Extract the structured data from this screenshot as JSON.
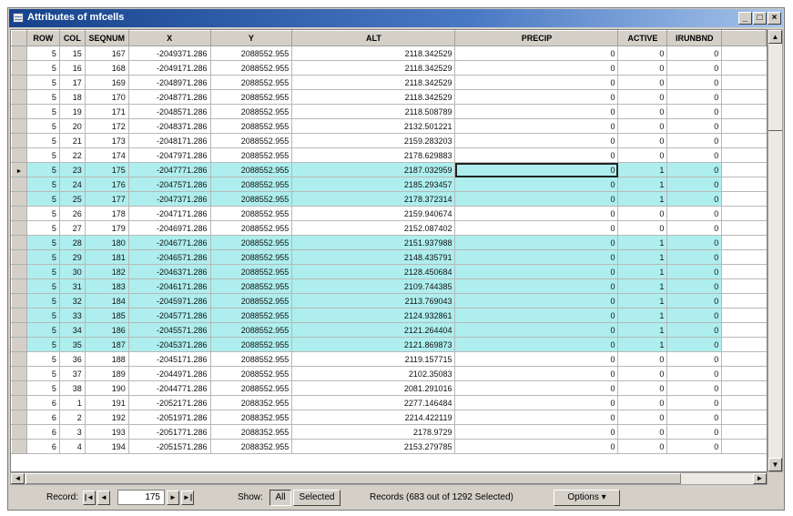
{
  "window": {
    "title": "Attributes of mfcells"
  },
  "titlebar_buttons": {
    "minimize": "_",
    "maximize": "□",
    "close": "×"
  },
  "table": {
    "columns": [
      "ROW",
      "COL",
      "SEQNUM",
      "X",
      "Y",
      "ALT",
      "PRECIP",
      "ACTIVE",
      "IRUNBND"
    ],
    "rows": [
      {
        "cells": [
          "5",
          "15",
          "167",
          "-2049371.286",
          "2088552.955",
          "2118.342529",
          "0",
          "0",
          "0"
        ],
        "highlighted": false
      },
      {
        "cells": [
          "5",
          "16",
          "168",
          "-2049171.286",
          "2088552.955",
          "2118.342529",
          "0",
          "0",
          "0"
        ],
        "highlighted": false
      },
      {
        "cells": [
          "5",
          "17",
          "169",
          "-2048971.286",
          "2088552.955",
          "2118.342529",
          "0",
          "0",
          "0"
        ],
        "highlighted": false
      },
      {
        "cells": [
          "5",
          "18",
          "170",
          "-2048771.286",
          "2088552.955",
          "2118.342529",
          "0",
          "0",
          "0"
        ],
        "highlighted": false
      },
      {
        "cells": [
          "5",
          "19",
          "171",
          "-2048571.286",
          "2088552.955",
          "2118.508789",
          "0",
          "0",
          "0"
        ],
        "highlighted": false
      },
      {
        "cells": [
          "5",
          "20",
          "172",
          "-2048371.286",
          "2088552.955",
          "2132.501221",
          "0",
          "0",
          "0"
        ],
        "highlighted": false
      },
      {
        "cells": [
          "5",
          "21",
          "173",
          "-2048171.286",
          "2088552.955",
          "2159.283203",
          "0",
          "0",
          "0"
        ],
        "highlighted": false
      },
      {
        "cells": [
          "5",
          "22",
          "174",
          "-2047971.286",
          "2088552.955",
          "2178.629883",
          "0",
          "0",
          "0"
        ],
        "highlighted": false
      },
      {
        "cells": [
          "5",
          "23",
          "175",
          "-2047771.286",
          "2088552.955",
          "2187.032959",
          "0",
          "1",
          "0"
        ],
        "highlighted": true,
        "current": true
      },
      {
        "cells": [
          "5",
          "24",
          "176",
          "-2047571.286",
          "2088552.955",
          "2185.293457",
          "0",
          "1",
          "0"
        ],
        "highlighted": true
      },
      {
        "cells": [
          "5",
          "25",
          "177",
          "-2047371.286",
          "2088552.955",
          "2178.372314",
          "0",
          "1",
          "0"
        ],
        "highlighted": true
      },
      {
        "cells": [
          "5",
          "26",
          "178",
          "-2047171.286",
          "2088552.955",
          "2159.940674",
          "0",
          "0",
          "0"
        ],
        "highlighted": false
      },
      {
        "cells": [
          "5",
          "27",
          "179",
          "-2046971.286",
          "2088552.955",
          "2152.087402",
          "0",
          "0",
          "0"
        ],
        "highlighted": false
      },
      {
        "cells": [
          "5",
          "28",
          "180",
          "-2046771.286",
          "2088552.955",
          "2151.937988",
          "0",
          "1",
          "0"
        ],
        "highlighted": true
      },
      {
        "cells": [
          "5",
          "29",
          "181",
          "-2046571.286",
          "2088552.955",
          "2148.435791",
          "0",
          "1",
          "0"
        ],
        "highlighted": true
      },
      {
        "cells": [
          "5",
          "30",
          "182",
          "-2046371.286",
          "2088552.955",
          "2128.450684",
          "0",
          "1",
          "0"
        ],
        "highlighted": true
      },
      {
        "cells": [
          "5",
          "31",
          "183",
          "-2046171.286",
          "2088552.955",
          "2109.744385",
          "0",
          "1",
          "0"
        ],
        "highlighted": true
      },
      {
        "cells": [
          "5",
          "32",
          "184",
          "-2045971.286",
          "2088552.955",
          "2113.769043",
          "0",
          "1",
          "0"
        ],
        "highlighted": true
      },
      {
        "cells": [
          "5",
          "33",
          "185",
          "-2045771.286",
          "2088552.955",
          "2124.932861",
          "0",
          "1",
          "0"
        ],
        "highlighted": true
      },
      {
        "cells": [
          "5",
          "34",
          "186",
          "-2045571.286",
          "2088552.955",
          "2121.264404",
          "0",
          "1",
          "0"
        ],
        "highlighted": true
      },
      {
        "cells": [
          "5",
          "35",
          "187",
          "-2045371.286",
          "2088552.955",
          "2121.869873",
          "0",
          "1",
          "0"
        ],
        "highlighted": true
      },
      {
        "cells": [
          "5",
          "36",
          "188",
          "-2045171.286",
          "2088552.955",
          "2119.157715",
          "0",
          "0",
          "0"
        ],
        "highlighted": false
      },
      {
        "cells": [
          "5",
          "37",
          "189",
          "-2044971.286",
          "2088552.955",
          "2102.35083",
          "0",
          "0",
          "0"
        ],
        "highlighted": false
      },
      {
        "cells": [
          "5",
          "38",
          "190",
          "-2044771.286",
          "2088552.955",
          "2081.291016",
          "0",
          "0",
          "0"
        ],
        "highlighted": false
      },
      {
        "cells": [
          "6",
          "1",
          "191",
          "-2052171.286",
          "2088352.955",
          "2277.146484",
          "0",
          "0",
          "0"
        ],
        "highlighted": false
      },
      {
        "cells": [
          "6",
          "2",
          "192",
          "-2051971.286",
          "2088352.955",
          "2214.422119",
          "0",
          "0",
          "0"
        ],
        "highlighted": false
      },
      {
        "cells": [
          "6",
          "3",
          "193",
          "-2051771.286",
          "2088352.955",
          "2178.9729",
          "0",
          "0",
          "0"
        ],
        "highlighted": false
      },
      {
        "cells": [
          "6",
          "4",
          "194",
          "-2051571.286",
          "2088352.955",
          "2153.279785",
          "0",
          "0",
          "0"
        ],
        "highlighted": false
      }
    ]
  },
  "statusbar": {
    "record_label": "Record:",
    "record_value": "175",
    "show_label": "Show:",
    "all_label": "All",
    "selected_label": "Selected",
    "records_text": "Records (683 out of 1292 Selected)",
    "options_label": "Options ▾"
  },
  "colors": {
    "highlight": "#aeeeee",
    "titlebar": "#16428b"
  },
  "icons": [
    "table-icon",
    "minimize-icon",
    "maximize-icon",
    "close-icon",
    "scroll-up-icon",
    "scroll-down-icon",
    "scroll-left-icon",
    "scroll-right-icon",
    "first-record-icon",
    "prev-record-icon",
    "next-record-icon",
    "last-record-icon",
    "current-row-arrow-icon"
  ]
}
